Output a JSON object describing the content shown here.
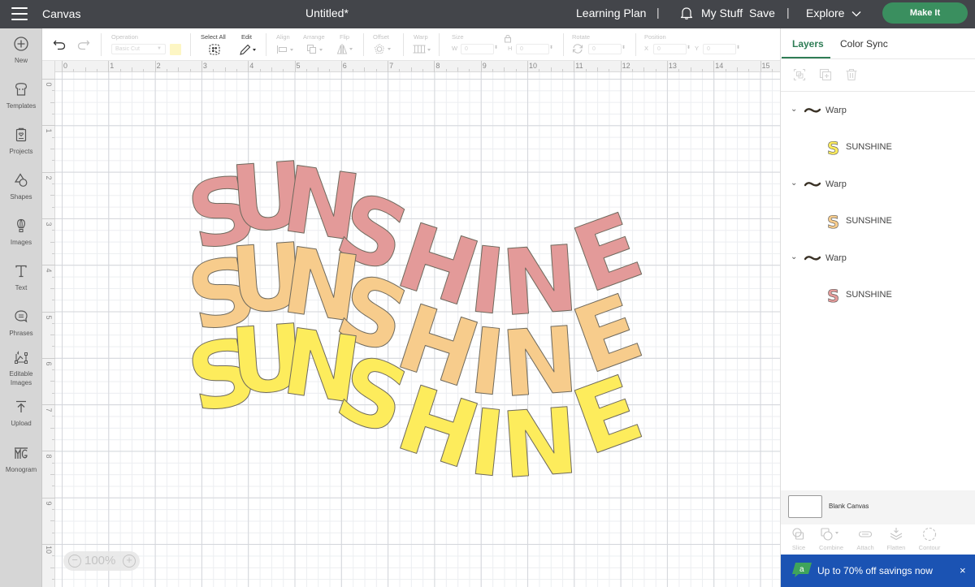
{
  "topbar": {
    "app_name": "Canvas",
    "document_title": "Untitled*",
    "learning_plan": "Learning Plan",
    "my_stuff": "My Stuff",
    "save": "Save",
    "explore": "Explore",
    "make_it": "Make It",
    "separator": "|"
  },
  "leftbar": {
    "items": [
      {
        "label": "New",
        "icon": "plus-circle-icon"
      },
      {
        "label": "Templates",
        "icon": "tshirt-icon"
      },
      {
        "label": "Projects",
        "icon": "project-icon"
      },
      {
        "label": "Shapes",
        "icon": "shapes-icon"
      },
      {
        "label": "Images",
        "icon": "balloon-icon"
      },
      {
        "label": "Text",
        "icon": "text-icon"
      },
      {
        "label": "Phrases",
        "icon": "speech-bubble-icon"
      },
      {
        "label": "Editable Images",
        "icon": "editable-image-icon"
      },
      {
        "label": "Upload",
        "icon": "upload-icon"
      },
      {
        "label": "Monogram",
        "icon": "monogram-icon"
      }
    ]
  },
  "toolbar": {
    "undo": "undo",
    "redo": "redo",
    "operation_label": "Operation",
    "operation_value": "Basic Cut",
    "operation_color": "#fdf6c4",
    "select_all_label": "Select All",
    "edit_label": "Edit",
    "align_label": "Align",
    "arrange_label": "Arrange",
    "flip_label": "Flip",
    "offset_label": "Offset",
    "warp_label": "Warp",
    "size_label": "Size",
    "w_label": "W",
    "w_value": "0",
    "h_label": "H",
    "h_value": "0",
    "rotate_label": "Rotate",
    "rotate_value": "0",
    "position_label": "Position",
    "x_label": "X",
    "x_value": "0",
    "y_label": "Y",
    "y_value": "0"
  },
  "rulers": {
    "top": [
      "0",
      "1",
      "2",
      "3",
      "4",
      "5",
      "6",
      "7",
      "8",
      "9",
      "10",
      "11",
      "12",
      "13",
      "14",
      "15"
    ],
    "left": [
      "0",
      "1",
      "2",
      "3",
      "4",
      "5",
      "6",
      "7",
      "8",
      "9",
      "10"
    ]
  },
  "canvas": {
    "zoom_level": "100%",
    "artwork": [
      {
        "text": "SUNSHINE",
        "color": "#e39a99",
        "effect": "Warp"
      },
      {
        "text": "SUNSHINE",
        "color": "#f7cc8c",
        "effect": "Warp"
      },
      {
        "text": "SUNSHINE",
        "color": "#fdec5c",
        "effect": "Warp"
      }
    ]
  },
  "rightpanel": {
    "tabs": [
      {
        "label": "Layers",
        "active": true
      },
      {
        "label": "Color Sync",
        "active": false
      }
    ],
    "layer_tools": [
      "group-icon",
      "duplicate-icon",
      "delete-icon"
    ],
    "layers": [
      {
        "group": "Warp",
        "child": "SUNSHINE",
        "color": "#fdec5c"
      },
      {
        "group": "Warp",
        "child": "SUNSHINE",
        "color": "#f7cc8c"
      },
      {
        "group": "Warp",
        "child": "SUNSHINE",
        "color": "#e39a99"
      }
    ],
    "blank_canvas": "Blank Canvas",
    "bottom_tools": [
      "Slice",
      "Combine",
      "Attach",
      "Flatten",
      "Contour"
    ],
    "promo": {
      "text": "Up to 70% off savings now",
      "close": "×",
      "logo_letter": "a"
    }
  }
}
